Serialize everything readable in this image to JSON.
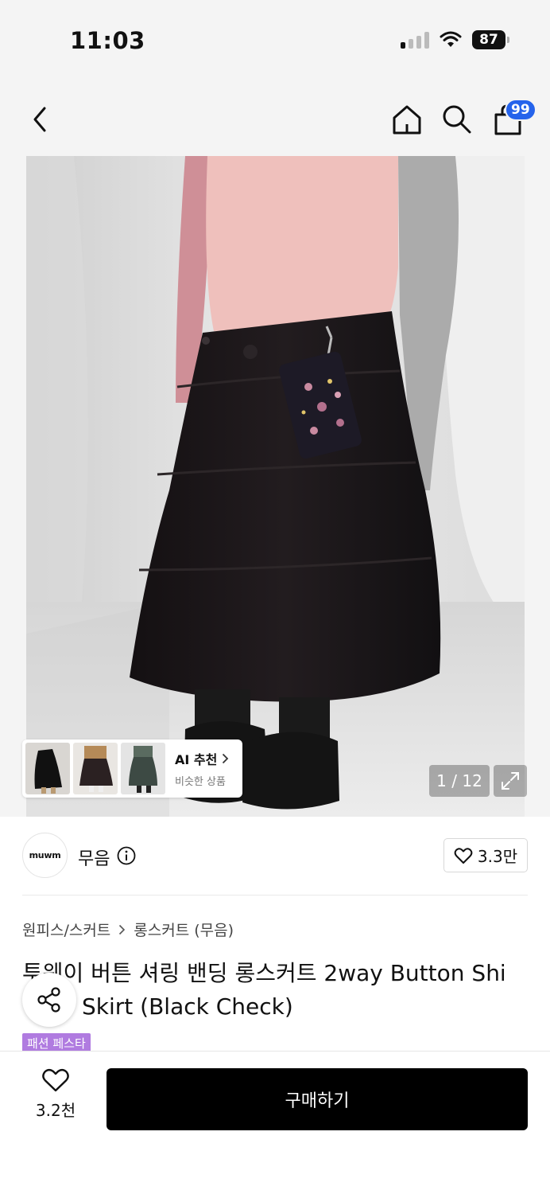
{
  "status_bar": {
    "time": "11:03",
    "battery": "87"
  },
  "nav": {
    "cart_badge": "99",
    "icons": [
      "back-icon",
      "home-icon",
      "search-icon",
      "cart-icon"
    ]
  },
  "gallery": {
    "page_indicator": "1 / 12",
    "ai_recommend": {
      "title": "AI 추천",
      "subtitle": "비슷한 상품"
    }
  },
  "brand": {
    "logo_text": "muwm",
    "name": "무음",
    "likes": "3.3만"
  },
  "breadcrumb": {
    "category": "원피스/스커트",
    "subcategory": "롱스커트 (무음)"
  },
  "product": {
    "title_line1": "투웨이 버튼 셔링 밴딩 롱스커트 2way Button Shi",
    "title_line2": "Skirt (Black Check)",
    "tag": "패션 페스타"
  },
  "bottom_bar": {
    "wish_count": "3.2천",
    "buy_label": "구매하기"
  },
  "colors": {
    "accent_badge": "#2563eb",
    "buy_button": "#000000",
    "festa_tag": "#b07be0"
  }
}
